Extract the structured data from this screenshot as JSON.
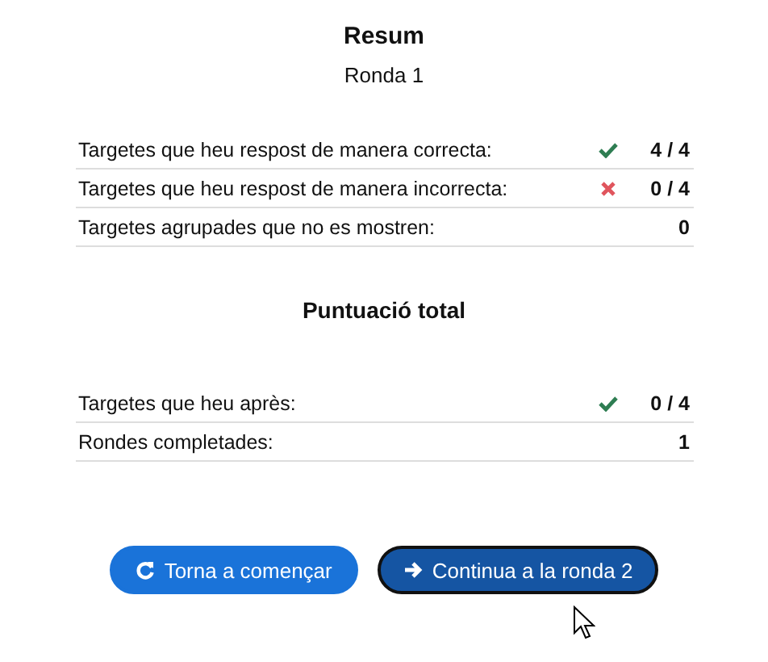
{
  "title": "Resum",
  "subtitle": "Ronda 1",
  "round_rows": [
    {
      "label": "Targetes que heu respost de manera correcta:",
      "kind": "check",
      "value": "4 / 4"
    },
    {
      "label": "Targetes que heu respost de manera incorrecta:",
      "kind": "cross",
      "value": "0 / 4"
    },
    {
      "label": "Targetes agrupades que no es mostren:",
      "kind": "none",
      "value": "0"
    }
  ],
  "total_title": "Puntuació total",
  "total_rows": [
    {
      "label": "Targetes que heu après:",
      "kind": "check",
      "value": "0 / 4"
    },
    {
      "label": "Rondes completades:",
      "kind": "none",
      "value": "1"
    }
  ],
  "buttons": [
    {
      "label": "Torna a començar",
      "kind": "restart",
      "focused": false
    },
    {
      "label": "Continua a la ronda 2",
      "kind": "next",
      "focused": true
    }
  ]
}
